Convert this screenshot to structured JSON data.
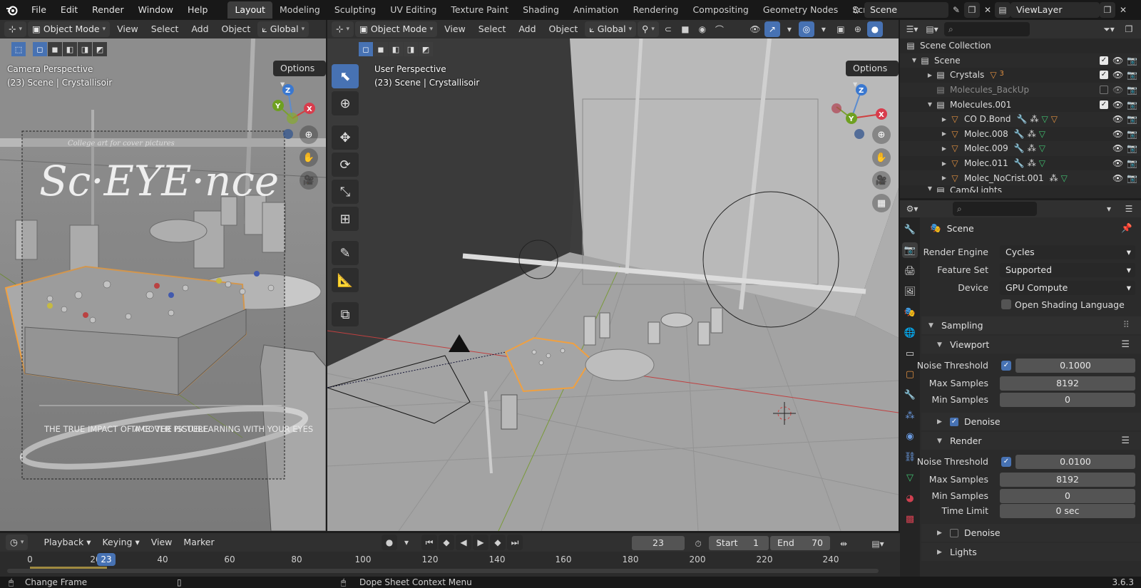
{
  "menu": [
    "File",
    "Edit",
    "Render",
    "Window",
    "Help"
  ],
  "workspaces": [
    "Layout",
    "Modeling",
    "Sculpting",
    "UV Editing",
    "Texture Paint",
    "Shading",
    "Animation",
    "Rendering",
    "Compositing",
    "Geometry Nodes",
    "Scripting"
  ],
  "active_workspace": "Layout",
  "scene_name": "Scene",
  "view_layer": "ViewLayer",
  "left_viewport": {
    "mode": "Object Mode",
    "menus": [
      "View",
      "Select",
      "Add",
      "Object"
    ],
    "orientation": "Global",
    "options": "Options",
    "perspective": "Camera Perspective",
    "scene_info": "(23) Scene | Crystallisoir",
    "poster_title": "Sc·EYE·nce",
    "poster_tagline": "College art for cover pictures",
    "poster_cols": [
      "THE TRUE IMPACT OF A COVER PICTURE",
      "TIME: THE ISSUE",
      "LEARNING WITH YOUR EYES"
    ]
  },
  "right_viewport": {
    "mode": "Object Mode",
    "menus": [
      "View",
      "Select",
      "Add",
      "Object"
    ],
    "orientation": "Global",
    "options": "Options",
    "perspective": "User Perspective",
    "scene_info": "(23) Scene | Crystallisoir"
  },
  "gizmo": {
    "x": "X",
    "y": "Y",
    "z": "Z"
  },
  "outliner": {
    "root": "Scene Collection",
    "rows": [
      {
        "name": "Scene",
        "indent": 1,
        "icon": "collection",
        "expanded": true
      },
      {
        "name": "Crystals",
        "indent": 2,
        "icon": "collection",
        "badge": "3"
      },
      {
        "name": "Molecules_BackUp",
        "indent": 2,
        "icon": "collection",
        "dim": true
      },
      {
        "name": "Molecules.001",
        "indent": 2,
        "icon": "collection",
        "expanded": true
      },
      {
        "name": "CO D.Bond",
        "indent": 3,
        "icon": "mesh"
      },
      {
        "name": "Molec.008",
        "indent": 3,
        "icon": "mesh"
      },
      {
        "name": "Molec.009",
        "indent": 3,
        "icon": "mesh"
      },
      {
        "name": "Molec.011",
        "indent": 3,
        "icon": "mesh"
      },
      {
        "name": "Molec_NoCrist.001",
        "indent": 3,
        "icon": "mesh"
      },
      {
        "name": "Cam&Lights",
        "indent": 2,
        "icon": "collection"
      }
    ]
  },
  "properties": {
    "context": "Scene",
    "render_engine_label": "Render Engine",
    "render_engine": "Cycles",
    "feature_set_label": "Feature Set",
    "feature_set": "Supported",
    "device_label": "Device",
    "device": "GPU Compute",
    "osl_label": "Open Shading Language",
    "sampling": "Sampling",
    "viewport": "Viewport",
    "render": "Render",
    "noise_threshold_label": "Noise Threshold",
    "max_samples_label": "Max Samples",
    "min_samples_label": "Min Samples",
    "time_limit_label": "Time Limit",
    "denoise_label": "Denoise",
    "viewport_noise": "0.1000",
    "viewport_max": "8192",
    "viewport_min": "0",
    "render_noise": "0.0100",
    "render_max": "8192",
    "render_min": "0",
    "time_limit": "0 sec",
    "lights": "Lights"
  },
  "timeline": {
    "menus": [
      "Playback",
      "Keying",
      "View",
      "Marker"
    ],
    "current_frame": "23",
    "start_label": "Start",
    "start": "1",
    "end_label": "End",
    "end": "70",
    "ticks": [
      "0",
      "20",
      "40",
      "60",
      "80",
      "100",
      "120",
      "140",
      "160",
      "180",
      "200",
      "220",
      "240"
    ]
  },
  "status": {
    "left": "Change Frame",
    "middle": "Dope Sheet Context Menu",
    "version": "3.6.3"
  }
}
